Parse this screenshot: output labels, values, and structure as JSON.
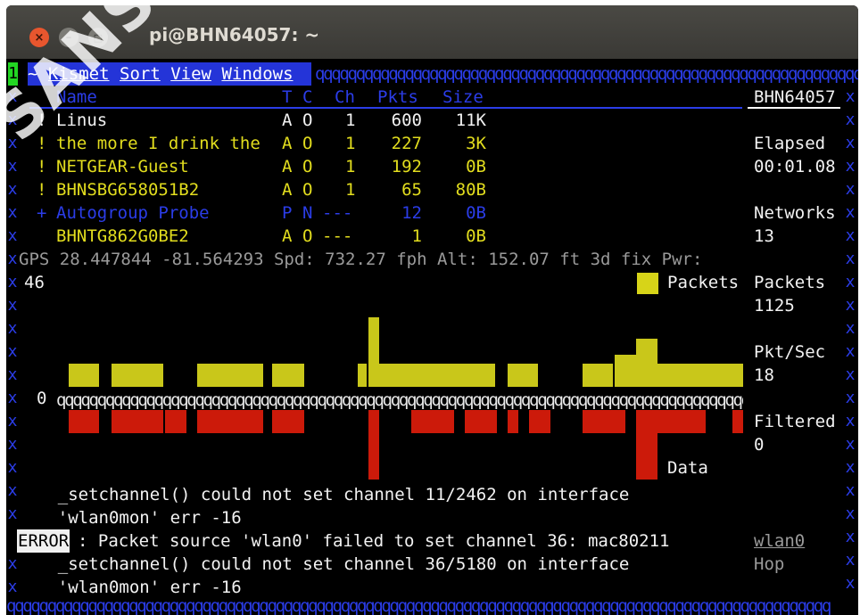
{
  "window": {
    "title": "pi@BHN64057: ~",
    "buttons": {
      "close": "×",
      "minimize": "–",
      "maximize": "□"
    }
  },
  "terminal": {
    "cursor_tag": "1",
    "menu": {
      "tilde": "~",
      "items": [
        "Kismet",
        "Sort",
        "View",
        "Windows"
      ]
    },
    "border_q": "qqqqqqqqqqqqqqqqqqqqqqqqqqqqqqqqqqqqqqqqqqqqqqqqqqqqqqqqqqqqqqqqqqqqqqqqqqqqqqqqqqqqqqqqqqqqqqqqqqqqq",
    "columns": [
      "Name",
      "T",
      "C",
      "Ch",
      "Pkts",
      "Size"
    ],
    "networks": [
      {
        "flag": "!",
        "name": "Linus",
        "t": "A",
        "c": "O",
        "ch": "1",
        "pkts": "600",
        "size": "11K",
        "color": "white"
      },
      {
        "flag": "!",
        "name": "the more I drink the",
        "t": "A",
        "c": "O",
        "ch": "1",
        "pkts": "227",
        "size": "3K",
        "color": "yellow"
      },
      {
        "flag": "!",
        "name": "NETGEAR-Guest",
        "t": "A",
        "c": "O",
        "ch": "1",
        "pkts": "192",
        "size": "0B",
        "color": "yellow"
      },
      {
        "flag": "!",
        "name": "BHNSBG658051B2",
        "t": "A",
        "c": "O",
        "ch": "1",
        "pkts": "65",
        "size": "80B",
        "color": "yellow"
      },
      {
        "flag": "+",
        "name": "Autogroup Probe",
        "t": "P",
        "c": "N",
        "ch": "---",
        "pkts": "12",
        "size": "0B",
        "color": "blue"
      },
      {
        "flag": "",
        "name": "BHNTG862G0BE2",
        "t": "A",
        "c": "O",
        "ch": "---",
        "pkts": "1",
        "size": "0B",
        "color": "yellow"
      }
    ],
    "gps_line": "GPS 28.447844 -81.564293 Spd: 732.27 fph Alt: 152.07 ft 3d fix Pwr:",
    "graph": {
      "max_label": "46",
      "zero_label": "0",
      "axis_q": "qqqqqqqqqqqqqqqqqqqqqqqqqqqqqqqqqqqqqqqqqqqqqqqqqqqqqqqqqqqqqqqqqqqqqqqqqqqqqqqqqqqqqqqqqqqqqqqqq",
      "packets_legend": "Packets",
      "data_legend": "Data"
    },
    "sidebar": {
      "host": "BHN64057",
      "elapsed_label": "Elapsed",
      "elapsed_value": "00:01.08",
      "networks_label": "Networks",
      "networks_value": "13",
      "packets_label": "Packets",
      "packets_value": "1125",
      "pktsec_label": "Pkt/Sec",
      "pktsec_value": "18",
      "filtered_label": "Filtered",
      "filtered_value": "0",
      "source_name": "wlan0",
      "source_mode": "Hop"
    },
    "log": {
      "line1": "    _setchannel() could not set channel 11/2462 on interface",
      "line2": "    'wlan0mon' err -16",
      "error_tag": "ERROR",
      "line3": ": Packet source 'wlan0' failed to set channel 36: mac80211",
      "line4": "    _setchannel() could not set channel 36/5180 on interface",
      "line5": "    'wlan0mon' err -16"
    },
    "colors": {
      "border_blue": "#2b3de8",
      "packets_yellow": "#c9c71a",
      "data_red": "#cc1a0a",
      "menu_bg": "#2434d8"
    }
  },
  "watermark": "SANS Institute"
}
